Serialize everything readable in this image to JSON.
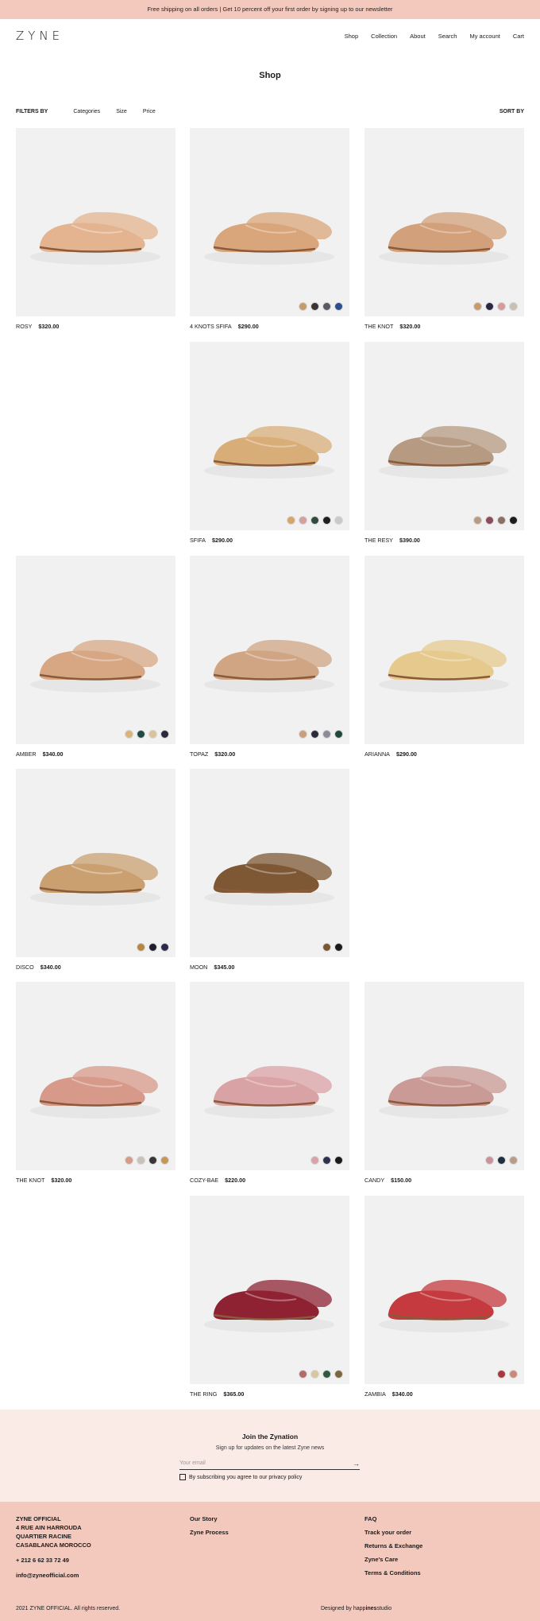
{
  "topbar": {
    "text": "Free shipping on all orders | Get 10 percent off your first order by signing up to our newsletter"
  },
  "header": {
    "logo": "ZYNE",
    "nav": [
      "Shop",
      "Collection",
      "About",
      "Search",
      "My account",
      "Cart"
    ]
  },
  "page": {
    "title": "Shop"
  },
  "filters": {
    "label": "FILTERS BY",
    "items": [
      "Categories",
      "Size",
      "Price"
    ],
    "sort": "SORT BY"
  },
  "products": [
    {
      "name": "ROSY",
      "price": "$320.00",
      "swatches": []
    },
    {
      "name": "4 KNOTS SFIFA",
      "price": "$290.00",
      "swatches": [
        "#c79a6b",
        "#3a3535",
        "#5a5a62",
        "#2f4f8a"
      ]
    },
    {
      "name": "THE KNOT",
      "price": "$320.00",
      "swatches": [
        "#c89a6c",
        "#2b2740",
        "#d99a9a",
        "#c9bfb3"
      ]
    },
    {
      "name": "SFIFA",
      "price": "$290.00",
      "swatches": [
        "#d4a66e",
        "#d4a09c",
        "#2f4a3e",
        "#1f1f1f",
        "#c9c9cc"
      ]
    },
    {
      "name": "THE RESY",
      "price": "$390.00",
      "swatches": [
        "#b89b80",
        "#8a4d5a",
        "#8a7062",
        "#1c1c1c"
      ]
    },
    {
      "name": "AMBER",
      "price": "$340.00",
      "swatches": [
        "#d9b47a",
        "#1f4a44",
        "#d8c39a",
        "#2a2a3a"
      ]
    },
    {
      "name": "TOPAZ",
      "price": "$320.00",
      "swatches": [
        "#c8a07a",
        "#2a2a3a",
        "#8c8c96",
        "#1f4a3a"
      ]
    },
    {
      "name": "ARIANNA",
      "price": "$290.00",
      "swatches": []
    },
    {
      "name": "DISCO",
      "price": "$340.00",
      "swatches": [
        "#b8873f",
        "#1d1d2f",
        "#2a2a4a"
      ]
    },
    {
      "name": "MOON",
      "price": "$345.00",
      "swatches": [
        "#7a5532",
        "#1a1a1a"
      ]
    },
    {
      "name": "THE KNOT",
      "price": "$320.00",
      "swatches": [
        "#d69a88",
        "#c8c2bb",
        "#3a3535",
        "#c8955a"
      ]
    },
    {
      "name": "COZY-BAE",
      "price": "$220.00",
      "swatches": [
        "#d7a3a9",
        "#2e3050",
        "#1a1a1a"
      ]
    },
    {
      "name": "CANDY",
      "price": "$150.00",
      "swatches": [
        "#c9929a",
        "#1e3040",
        "#b89b8a"
      ]
    },
    {
      "name": "THE RING",
      "price": "$365.00",
      "swatches": [
        "#b36a6a",
        "#d8c8a0",
        "#2f5a40",
        "#7a6640"
      ]
    },
    {
      "name": "ZAMBIA",
      "price": "$340.00",
      "swatches": [
        "#a8383e",
        "#c98a7a"
      ]
    }
  ],
  "newsletter": {
    "title": "Join the Zynation",
    "subtitle": "Sign up for updates on the latest Zyne news",
    "placeholder": "Your email",
    "arrow": "→",
    "consent": "By subscribing you agree to our privacy policy"
  },
  "footer": {
    "address": [
      "ZYNE OFFICIAL",
      "4 RUE AIN HARROUDA",
      "QUARTIER RACINE",
      "CASABLANCA MOROCCO"
    ],
    "phone": "+ 212 6 62 33 72 49",
    "email": "info@zyneofficial.com",
    "links_mid": [
      "Our Story",
      "Zyne Process"
    ],
    "links_right": [
      "FAQ",
      "Track your order",
      "Returns & Exchange",
      "Zyne's Care",
      "Terms & Conditions"
    ],
    "copyright": "2021 ZYNE OFFICIAL. All rights reserved.",
    "designed_prefix": "Designed by happ",
    "designed_bold": "ines",
    "designed_suffix": "studio"
  },
  "colors": {
    "topbar": "#f4c9bd",
    "newsletter_bg": "#fbebe6",
    "footer_bg": "#f4c9bd",
    "card_bg": "#f1f1f1"
  }
}
